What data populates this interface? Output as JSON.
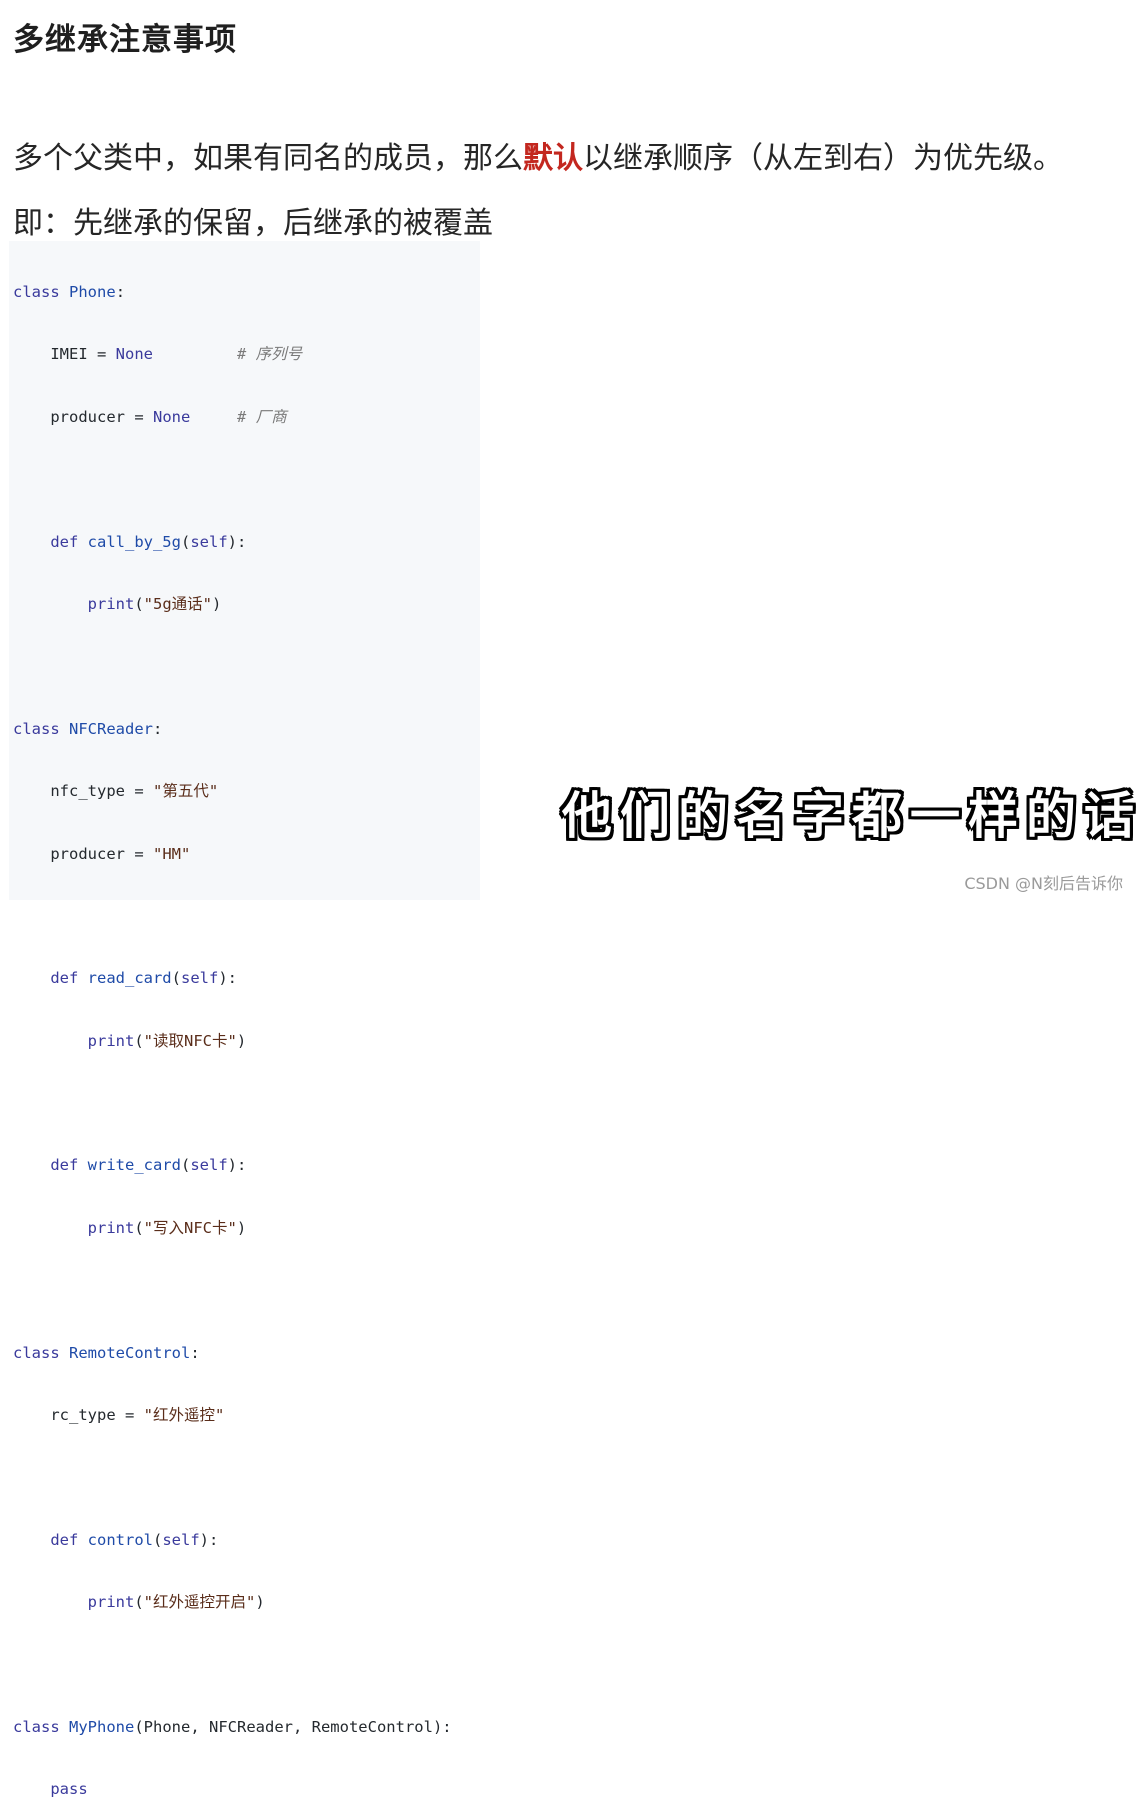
{
  "title": "多继承注意事项",
  "para1": {
    "before": "多个父类中，如果有同名的成员，那么",
    "highlight": "默认",
    "after": "以继承顺序（从左到右）为优先级。"
  },
  "para2": "即：先继承的保留，后继承的被覆盖",
  "code": {
    "l1_kw": "class",
    "l1_name": "Phone",
    "l1_end": ":",
    "l2_code": "    IMEI = ",
    "l2_val": "None",
    "l2_pad": "         ",
    "l2_comment": "# 序列号",
    "l3_code": "    producer = ",
    "l3_val": "None",
    "l3_pad": "     ",
    "l3_comment": "# 厂商",
    "l5_kw": "    def ",
    "l5_fn": "call_by_5g",
    "l5_open": "(",
    "l5_self": "self",
    "l5_close": "):",
    "l6_fn": "        print",
    "l6_open": "(",
    "l6_str": "\"5g通话\"",
    "l6_close": ")",
    "l8_kw": "class",
    "l8_name": "NFCReader",
    "l8_end": ":",
    "l9_code": "    nfc_type = ",
    "l9_str": "\"第五代\"",
    "l10_code": "    producer = ",
    "l10_str": "\"HM\"",
    "l12_kw": "    def ",
    "l12_fn": "read_card",
    "l12_open": "(",
    "l12_self": "self",
    "l12_close": "):",
    "l13_fn": "        print",
    "l13_open": "(",
    "l13_str": "\"读取NFC卡\"",
    "l13_close": ")",
    "l15_kw": "    def ",
    "l15_fn": "write_card",
    "l15_open": "(",
    "l15_self": "self",
    "l15_close": "):",
    "l16_fn": "        print",
    "l16_open": "(",
    "l16_str": "\"写入NFC卡\"",
    "l16_close": ")",
    "l18_kw": "class",
    "l18_name": "RemoteControl",
    "l18_end": ":",
    "l19_code": "    rc_type = ",
    "l19_str": "\"红外遥控\"",
    "l21_kw": "    def ",
    "l21_fn": "control",
    "l21_open": "(",
    "l21_self": "self",
    "l21_close": "):",
    "l22_fn": "        print",
    "l22_open": "(",
    "l22_str": "\"红外遥控开启\"",
    "l22_close": ")",
    "l24_kw": "class",
    "l24_name": "MyPhone",
    "l24_rest": "(Phone, NFCReader, RemoteControl):",
    "l25_kw": "    pass"
  },
  "subtitle": "他们的名字都一样的话",
  "watermark": "CSDN @N刻后告诉你"
}
